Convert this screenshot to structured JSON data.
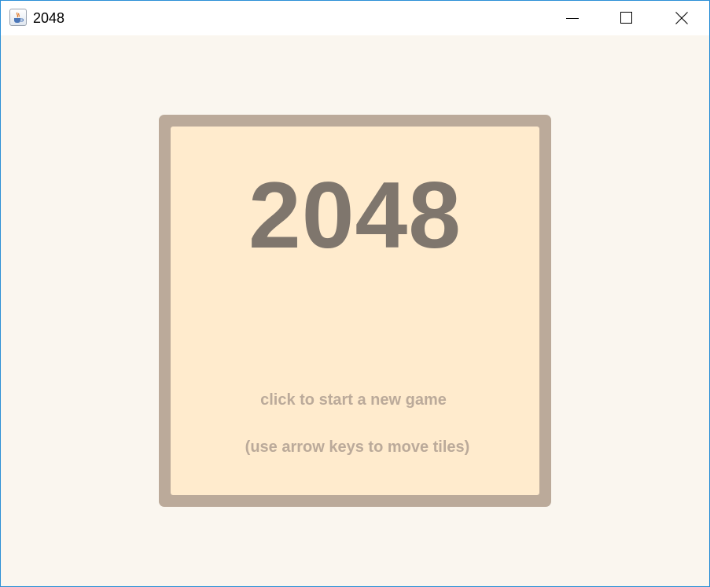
{
  "window": {
    "title": "2048",
    "app_icon": "java-cup-icon",
    "controls": {
      "minimize": "minimize-icon",
      "maximize": "maximize-icon",
      "close": "close-icon"
    }
  },
  "game": {
    "title": "2048",
    "start_hint": "click to start a new game",
    "controls_hint": "(use arrow keys to move tiles)"
  },
  "colors": {
    "background": "#faf6ef",
    "board_border": "#bbaa9a",
    "board_fill": "#ffebcd",
    "title_text": "#7f766d",
    "hint_text": "#bbaa9a"
  }
}
